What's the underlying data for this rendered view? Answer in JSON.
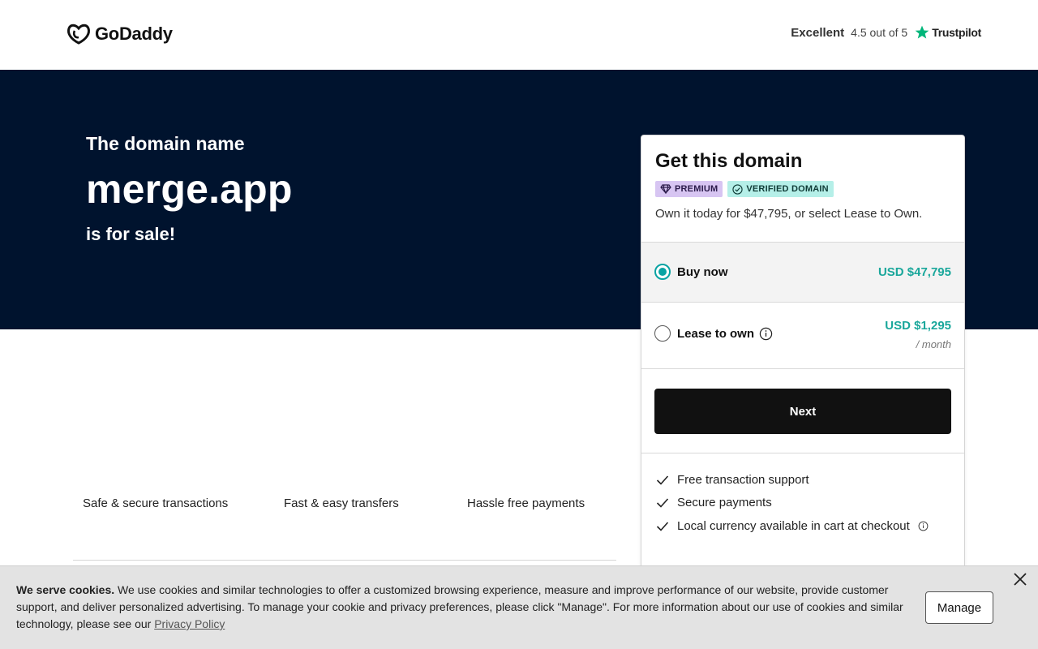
{
  "header": {
    "brand": "GoDaddy",
    "trustpilot": {
      "rating_word": "Excellent",
      "score": "4.5 out of 5",
      "brand": "Trustpilot"
    }
  },
  "hero": {
    "pre": "The domain name",
    "domain": "merge.app",
    "post": "is for sale!"
  },
  "features": [
    "Safe & secure transactions",
    "Fast & easy transfers",
    "Hassle free payments"
  ],
  "card": {
    "title": "Get this domain",
    "badges": {
      "premium": "PREMIUM",
      "verified": "VERIFIED DOMAIN"
    },
    "description": "Own it today for $47,795, or select Lease to Own.",
    "options": [
      {
        "label": "Buy now",
        "price": "USD $47,795",
        "selected": true
      },
      {
        "label": "Lease to own",
        "price": "USD $1,295",
        "per": "/ month",
        "selected": false
      }
    ],
    "next_label": "Next",
    "perks": [
      "Free transaction support",
      "Secure payments",
      "Local currency available in cart at checkout"
    ]
  },
  "cookie": {
    "bold": "We serve cookies.",
    "text": " We use cookies and similar technologies to offer a customized browsing experience, measure and improve performance of our website, provide customer support, and deliver personalized advertising. To manage your cookie and privacy preferences, please click \"Manage\". For more information about our use of cookies and similar technology, please see our ",
    "link": "Privacy Policy",
    "manage_label": "Manage"
  },
  "colors": {
    "hero_bg": "#00132e",
    "accent_teal": "#1aa79b",
    "premium_badge": "#d7c5f2",
    "verified_badge": "#b5efe8",
    "button_dark": "#111111"
  }
}
